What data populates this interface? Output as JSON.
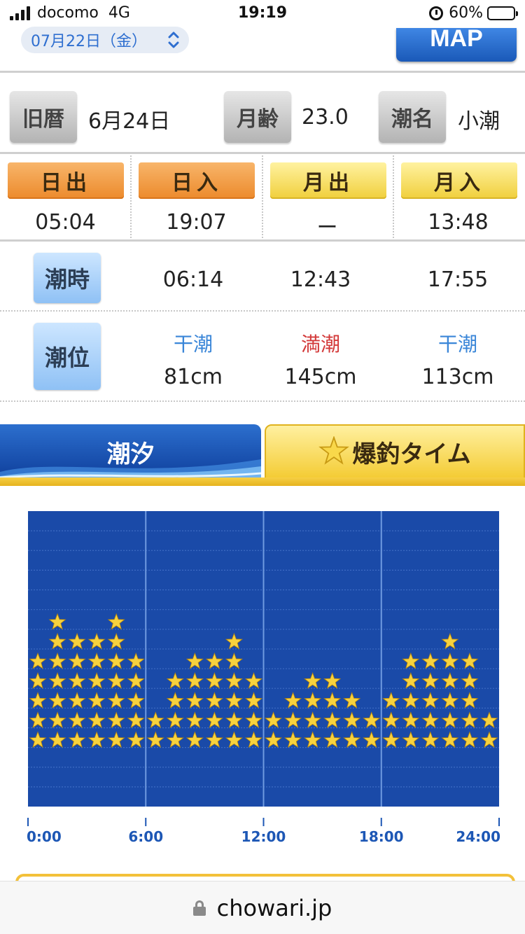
{
  "status_bar": {
    "carrier": "docomo",
    "network": "4G",
    "time": "19:19",
    "battery": "60%",
    "battery_level": 0.6
  },
  "header": {
    "date": "07月22日（金）",
    "map_label": "MAP"
  },
  "moon_info": [
    {
      "label": "旧暦",
      "value": "6月24日"
    },
    {
      "label": "月齢",
      "value": "23.0"
    },
    {
      "label": "潮名",
      "value": "小潮"
    }
  ],
  "sun_moon": [
    {
      "label": "日出",
      "time": "05:04",
      "style": "orange"
    },
    {
      "label": "日入",
      "time": "19:07",
      "style": "orange"
    },
    {
      "label": "月出",
      "time": "ー",
      "style": "yellow"
    },
    {
      "label": "月入",
      "time": "13:48",
      "style": "yellow"
    }
  ],
  "tide": {
    "time_label": "潮時",
    "level_label": "潮位",
    "events": [
      {
        "time": "06:14",
        "type": "干潮",
        "level": "81cm",
        "color": "#3a86d8"
      },
      {
        "time": "12:43",
        "type": "満潮",
        "level": "145cm",
        "color": "#d33a3a"
      },
      {
        "time": "17:55",
        "type": "干潮",
        "level": "113cm",
        "color": "#3a86d8"
      }
    ]
  },
  "tabs": {
    "tide": "潮汐",
    "fishing": "爆釣タイム"
  },
  "chart_data": {
    "type": "bar",
    "x_ticks": [
      "0:00",
      "6:00",
      "12:00",
      "18:00",
      "24:00"
    ],
    "x_range": [
      0,
      24
    ],
    "y_range": [
      0,
      15
    ],
    "grid": true,
    "star_color": "#f7d23e",
    "background": "#1a4aa8",
    "hours": [
      0,
      1,
      2,
      3,
      4,
      5,
      6,
      7,
      8,
      9,
      10,
      11,
      12,
      13,
      14,
      15,
      16,
      17,
      18,
      19,
      20,
      21,
      22,
      23
    ],
    "values": [
      5,
      7,
      6,
      6,
      7,
      5,
      2,
      4,
      5,
      5,
      6,
      4,
      2,
      3,
      4,
      4,
      3,
      2,
      3,
      5,
      5,
      6,
      5,
      2
    ]
  },
  "footer": {
    "url": "chowari.jp"
  }
}
